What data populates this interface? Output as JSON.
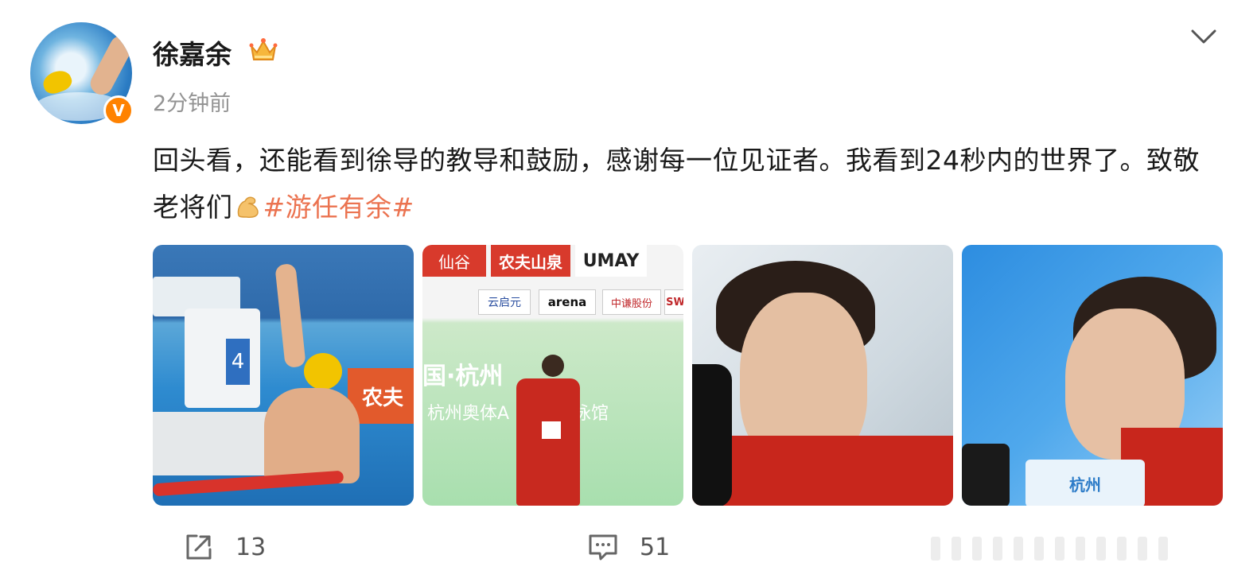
{
  "post": {
    "username": "徐嘉余",
    "time": "2分钟前",
    "verified_badge": "V",
    "text_main": "回头看，还能看到徐导的教导和鼓励，感谢每一位见证者。我看到24秒内的世界了。致敬老将们",
    "hashtag": "#游任有余#"
  },
  "photos": [
    {
      "alt": "swimmer raising fist at pool lane 4",
      "banner": "农夫"
    },
    {
      "banner_1": "仙谷",
      "banner_2": "农夫山泉",
      "banner_3": "UMAY",
      "banner_4": "云启元",
      "banner_5": "arena",
      "banner_6": "中谦股份",
      "banner_7": "SW",
      "wall_1": "国·杭州",
      "wall_2": "杭州奥体A",
      "wall_3": "泳馆"
    },
    {
      "alt": "close-up portrait in red jacket"
    },
    {
      "alt": "interview with microphones",
      "mic_label": "杭州"
    }
  ],
  "footer": {
    "share_count": "13",
    "comment_count": "51"
  },
  "colors": {
    "hashtag": "#eb7350",
    "badge": "#ff8200",
    "meta_text": "#939393"
  },
  "icons": {
    "crown": "crown-icon",
    "chevron": "chevron-down-icon",
    "share": "share-icon",
    "comment": "comment-icon",
    "emoji": "flexed-biceps-emoji"
  }
}
